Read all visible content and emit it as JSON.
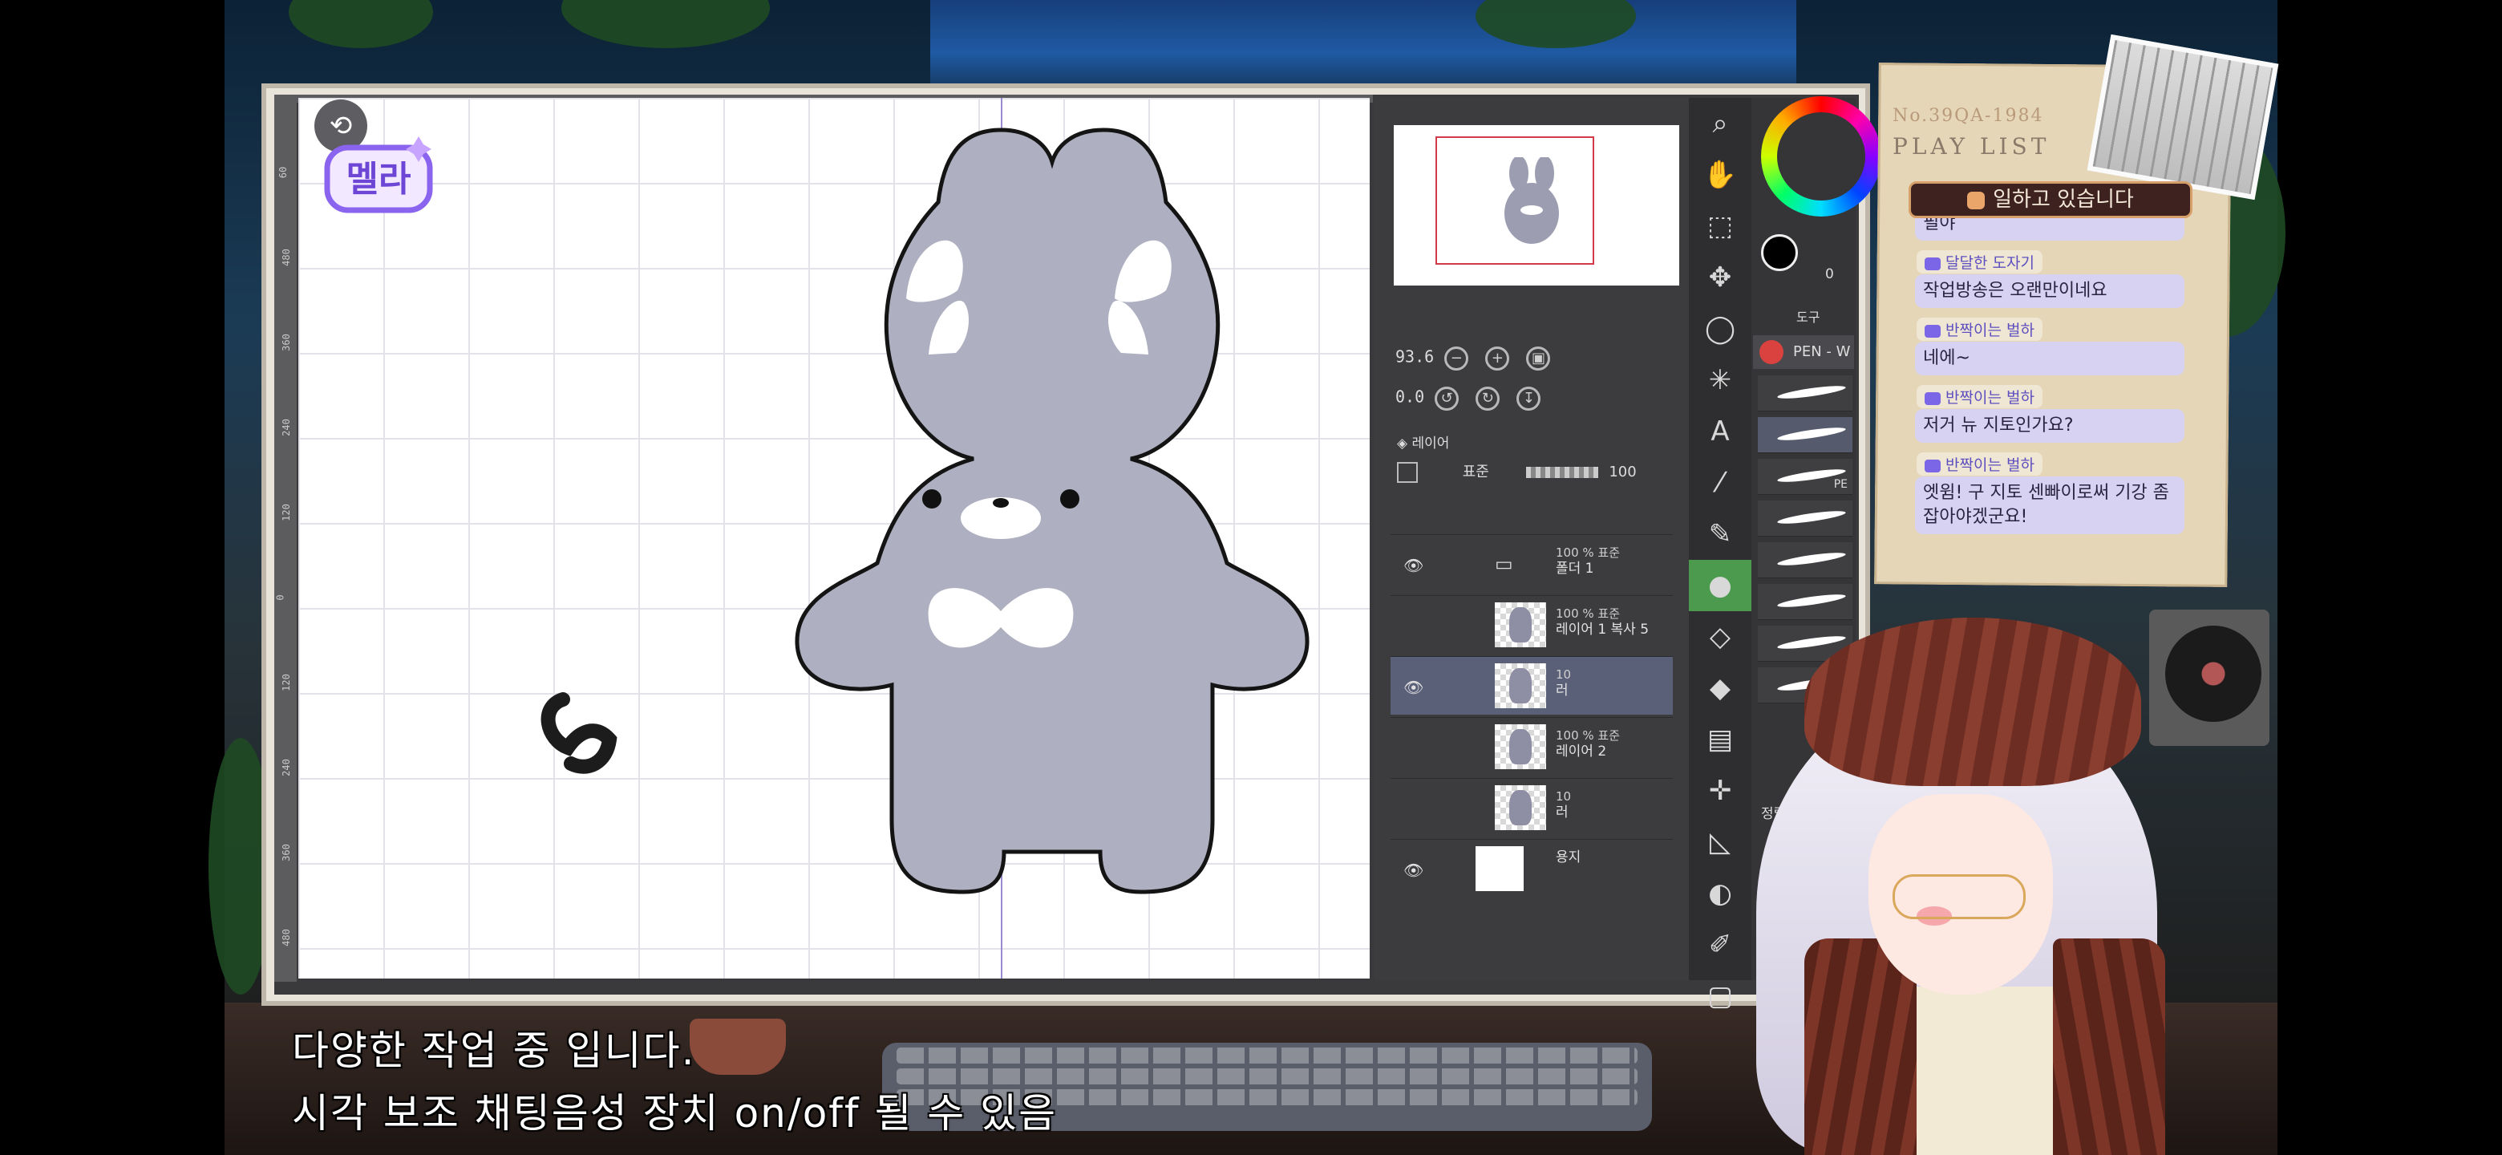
{
  "app": {
    "logo_text": "멜라",
    "ruler_ticks": [
      "60",
      "480",
      "360",
      "240",
      "120",
      "0",
      "120",
      "240",
      "360",
      "480"
    ]
  },
  "navigator": {
    "zoom_value": "93.6",
    "angle_value": "0.0"
  },
  "layers_panel": {
    "tab_label": "레이어",
    "blend_mode": "표준",
    "opacity": "100",
    "layers": [
      {
        "opacity_mode": "100 % 표준",
        "name": "폴더 1",
        "visible": true,
        "type": "folder"
      },
      {
        "opacity_mode": "100 % 표준",
        "name": "레이어 1 복사 5",
        "visible": false,
        "type": "raster"
      },
      {
        "opacity_mode": "10",
        "name": "러",
        "visible": true,
        "type": "raster",
        "selected": true
      },
      {
        "opacity_mode": "100 % 표준",
        "name": "레이어 2",
        "visible": false,
        "type": "raster"
      },
      {
        "opacity_mode": "10",
        "name": "러",
        "visible": false,
        "type": "raster"
      },
      {
        "opacity_mode": "",
        "name": "용지",
        "visible": true,
        "type": "paper"
      }
    ]
  },
  "color_panel": {
    "value_label": "0"
  },
  "brush_panel": {
    "tab_label": "도구",
    "pen_label": "PEN - W",
    "pen_label2": "PE",
    "sort_label": "정렬 기준",
    "sort_label2": "정렬"
  },
  "playlist": {
    "number": "No.39QA-1984",
    "title": "PLAY LIST",
    "status_badge": "일하고 있습니다",
    "clipped_message": "필야",
    "messages": [
      {
        "user": "달달한 도자기",
        "text": "작업방송은 오랜만이네요"
      },
      {
        "user": "반짝이는 벌하",
        "text": "네에~"
      },
      {
        "user": "반짝이는 벌하",
        "text": "저거 뉴 지토인가요?"
      },
      {
        "user": "반짝이는 벌하",
        "text": "엣윔! 구 지토 센빠이로써 기강 좀 잡아야겠군요!"
      }
    ]
  },
  "captions": {
    "line1": "다양한 작업 중 입니다.",
    "line2": "시각 보조 채팅음성 장치 on/off 될 수 있음"
  },
  "colors": {
    "canvas_bg": "#ffffff",
    "bunny_fill": "#aeafc0",
    "accent_guide": "#9a8ad0",
    "chat_bubble": "#d7d2f2",
    "badge_bg": "#3d2220"
  }
}
